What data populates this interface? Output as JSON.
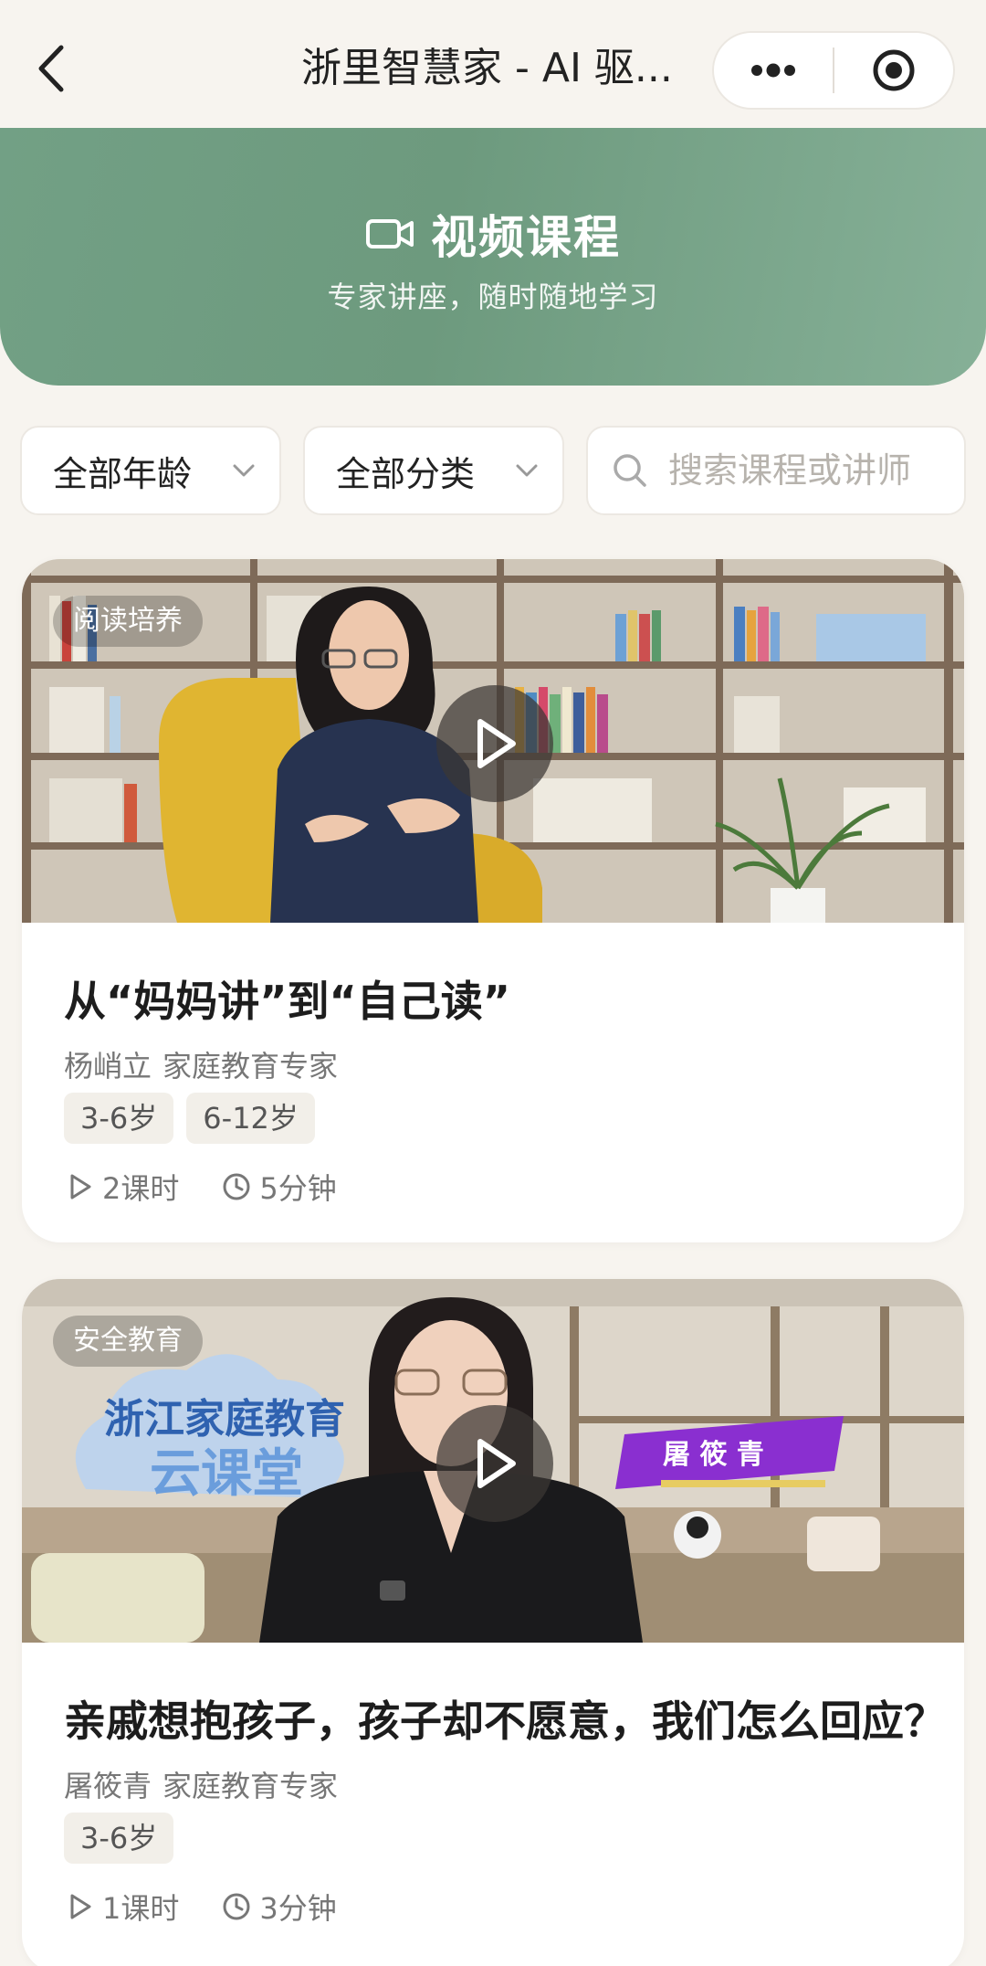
{
  "navbar": {
    "title": "浙里智慧家 - AI 驱...",
    "back_icon": "chevron-left-icon",
    "more_icon": "more-dots-icon",
    "target_icon": "target-icon"
  },
  "hero": {
    "title": "视频课程",
    "subtitle": "专家讲座，随时随地学习",
    "icon": "video-camera-icon",
    "colors": {
      "gradient_start": "#72a085",
      "gradient_end": "#86b097"
    }
  },
  "filters": {
    "age": {
      "selected": "全部年龄"
    },
    "category": {
      "selected": "全部分类"
    },
    "search": {
      "placeholder": "搜索课程或讲师",
      "value": ""
    }
  },
  "courses": [
    {
      "category": "阅读培养",
      "title": "从“妈妈讲”到“自己读”",
      "lecturer": "杨峭立",
      "role": "家庭教育专家",
      "tags": [
        "3-6岁",
        "6-12岁"
      ],
      "lessons": "2课时",
      "duration": "5分钟"
    },
    {
      "category": "安全教育",
      "title": "亲戚想抱孩子，孩子却不愿意，我们怎么回应？",
      "lecturer": "屠筱青",
      "role": "家庭教育专家",
      "tags": [
        "3-6岁"
      ],
      "lessons": "1课时",
      "duration": "3分钟",
      "thumbnail_text": {
        "logo_line1": "浙江家庭教育",
        "logo_line2": "云课堂",
        "name_tag": "屠 筱 青"
      }
    }
  ]
}
